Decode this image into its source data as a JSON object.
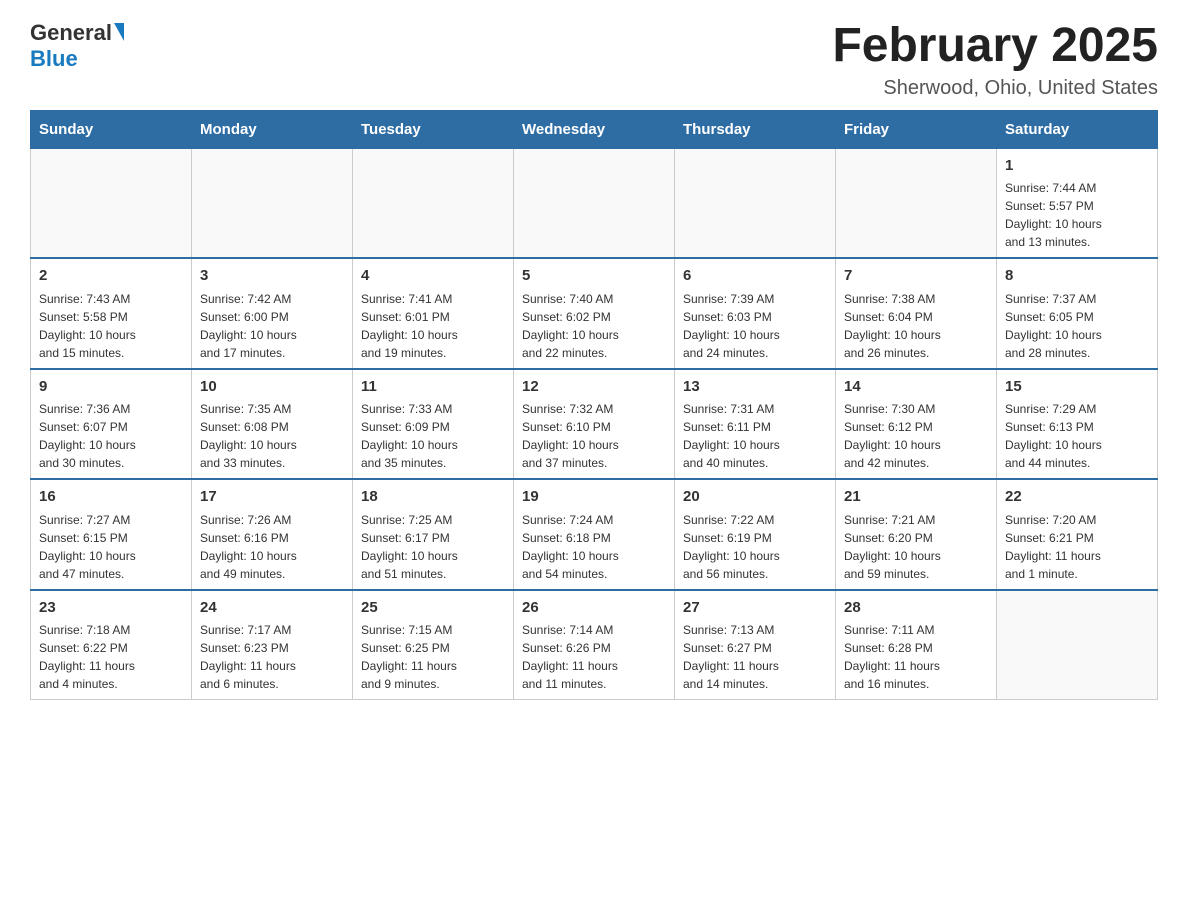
{
  "header": {
    "logo_general": "General",
    "logo_blue": "Blue",
    "month_title": "February 2025",
    "location": "Sherwood, Ohio, United States"
  },
  "weekdays": [
    "Sunday",
    "Monday",
    "Tuesday",
    "Wednesday",
    "Thursday",
    "Friday",
    "Saturday"
  ],
  "weeks": [
    {
      "days": [
        {
          "number": "",
          "info": ""
        },
        {
          "number": "",
          "info": ""
        },
        {
          "number": "",
          "info": ""
        },
        {
          "number": "",
          "info": ""
        },
        {
          "number": "",
          "info": ""
        },
        {
          "number": "",
          "info": ""
        },
        {
          "number": "1",
          "info": "Sunrise: 7:44 AM\nSunset: 5:57 PM\nDaylight: 10 hours\nand 13 minutes."
        }
      ]
    },
    {
      "days": [
        {
          "number": "2",
          "info": "Sunrise: 7:43 AM\nSunset: 5:58 PM\nDaylight: 10 hours\nand 15 minutes."
        },
        {
          "number": "3",
          "info": "Sunrise: 7:42 AM\nSunset: 6:00 PM\nDaylight: 10 hours\nand 17 minutes."
        },
        {
          "number": "4",
          "info": "Sunrise: 7:41 AM\nSunset: 6:01 PM\nDaylight: 10 hours\nand 19 minutes."
        },
        {
          "number": "5",
          "info": "Sunrise: 7:40 AM\nSunset: 6:02 PM\nDaylight: 10 hours\nand 22 minutes."
        },
        {
          "number": "6",
          "info": "Sunrise: 7:39 AM\nSunset: 6:03 PM\nDaylight: 10 hours\nand 24 minutes."
        },
        {
          "number": "7",
          "info": "Sunrise: 7:38 AM\nSunset: 6:04 PM\nDaylight: 10 hours\nand 26 minutes."
        },
        {
          "number": "8",
          "info": "Sunrise: 7:37 AM\nSunset: 6:05 PM\nDaylight: 10 hours\nand 28 minutes."
        }
      ]
    },
    {
      "days": [
        {
          "number": "9",
          "info": "Sunrise: 7:36 AM\nSunset: 6:07 PM\nDaylight: 10 hours\nand 30 minutes."
        },
        {
          "number": "10",
          "info": "Sunrise: 7:35 AM\nSunset: 6:08 PM\nDaylight: 10 hours\nand 33 minutes."
        },
        {
          "number": "11",
          "info": "Sunrise: 7:33 AM\nSunset: 6:09 PM\nDaylight: 10 hours\nand 35 minutes."
        },
        {
          "number": "12",
          "info": "Sunrise: 7:32 AM\nSunset: 6:10 PM\nDaylight: 10 hours\nand 37 minutes."
        },
        {
          "number": "13",
          "info": "Sunrise: 7:31 AM\nSunset: 6:11 PM\nDaylight: 10 hours\nand 40 minutes."
        },
        {
          "number": "14",
          "info": "Sunrise: 7:30 AM\nSunset: 6:12 PM\nDaylight: 10 hours\nand 42 minutes."
        },
        {
          "number": "15",
          "info": "Sunrise: 7:29 AM\nSunset: 6:13 PM\nDaylight: 10 hours\nand 44 minutes."
        }
      ]
    },
    {
      "days": [
        {
          "number": "16",
          "info": "Sunrise: 7:27 AM\nSunset: 6:15 PM\nDaylight: 10 hours\nand 47 minutes."
        },
        {
          "number": "17",
          "info": "Sunrise: 7:26 AM\nSunset: 6:16 PM\nDaylight: 10 hours\nand 49 minutes."
        },
        {
          "number": "18",
          "info": "Sunrise: 7:25 AM\nSunset: 6:17 PM\nDaylight: 10 hours\nand 51 minutes."
        },
        {
          "number": "19",
          "info": "Sunrise: 7:24 AM\nSunset: 6:18 PM\nDaylight: 10 hours\nand 54 minutes."
        },
        {
          "number": "20",
          "info": "Sunrise: 7:22 AM\nSunset: 6:19 PM\nDaylight: 10 hours\nand 56 minutes."
        },
        {
          "number": "21",
          "info": "Sunrise: 7:21 AM\nSunset: 6:20 PM\nDaylight: 10 hours\nand 59 minutes."
        },
        {
          "number": "22",
          "info": "Sunrise: 7:20 AM\nSunset: 6:21 PM\nDaylight: 11 hours\nand 1 minute."
        }
      ]
    },
    {
      "days": [
        {
          "number": "23",
          "info": "Sunrise: 7:18 AM\nSunset: 6:22 PM\nDaylight: 11 hours\nand 4 minutes."
        },
        {
          "number": "24",
          "info": "Sunrise: 7:17 AM\nSunset: 6:23 PM\nDaylight: 11 hours\nand 6 minutes."
        },
        {
          "number": "25",
          "info": "Sunrise: 7:15 AM\nSunset: 6:25 PM\nDaylight: 11 hours\nand 9 minutes."
        },
        {
          "number": "26",
          "info": "Sunrise: 7:14 AM\nSunset: 6:26 PM\nDaylight: 11 hours\nand 11 minutes."
        },
        {
          "number": "27",
          "info": "Sunrise: 7:13 AM\nSunset: 6:27 PM\nDaylight: 11 hours\nand 14 minutes."
        },
        {
          "number": "28",
          "info": "Sunrise: 7:11 AM\nSunset: 6:28 PM\nDaylight: 11 hours\nand 16 minutes."
        },
        {
          "number": "",
          "info": ""
        }
      ]
    }
  ]
}
